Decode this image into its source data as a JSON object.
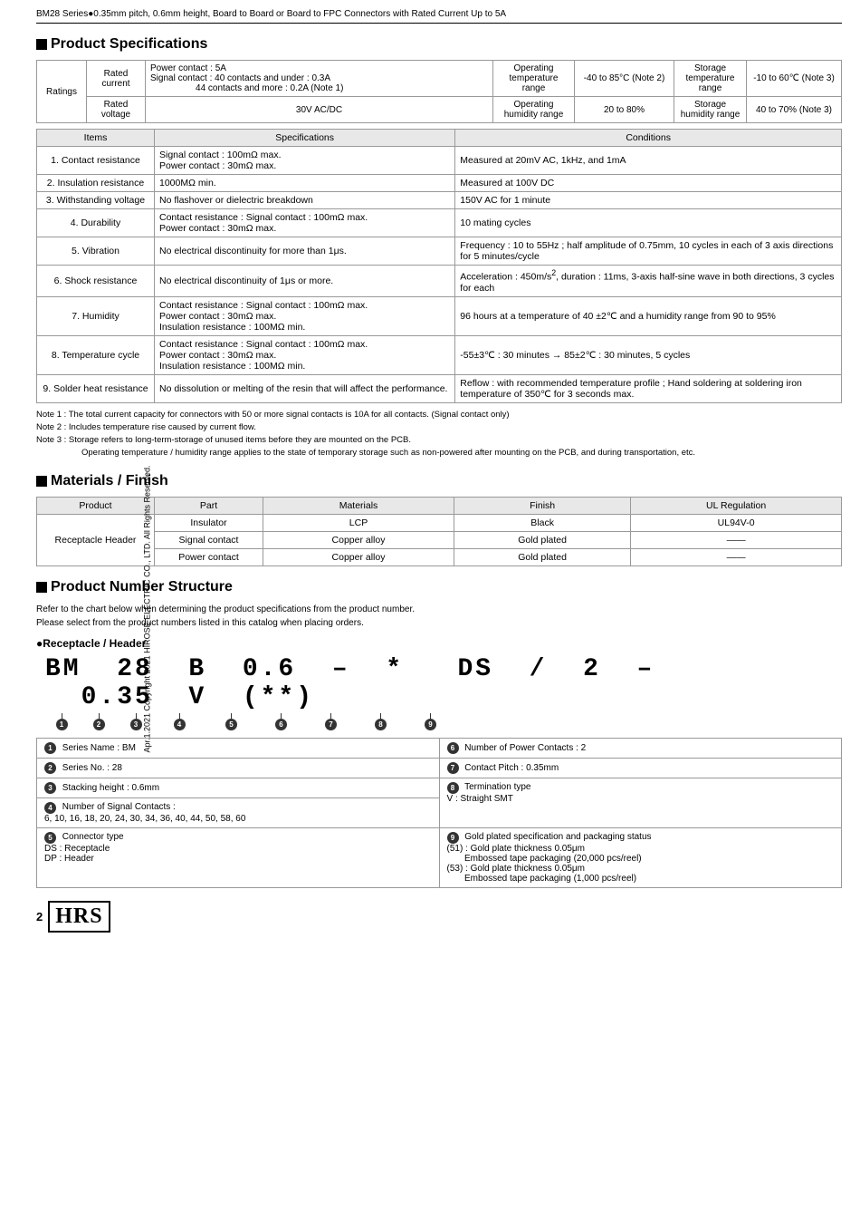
{
  "page": {
    "header": "BM28 Series●0.35mm pitch, 0.6mm height, Board to Board or Board to FPC Connectors with Rated Current Up to 5A",
    "side_text": "Apr.1.2021 Copyright 2021 HIROSE ELECTRIC CO., LTD. All Rights Reserved.",
    "page_number": "2"
  },
  "product_specs": {
    "heading": "Product Specifications",
    "ratings": {
      "rows": [
        {
          "label": "Ratings",
          "sub_label": "Rated current",
          "value": "Power contact : 5A\nSignal contact : 40 contacts and under : 0.3A\n44 contacts and more : 0.2A (Note 1)",
          "op_temp_label": "Operating temperature range",
          "op_temp_val": "-40 to 85°C (Note 2)",
          "storage_label": "Storage temperature range",
          "storage_val": "-10 to 60℃ (Note 3)"
        },
        {
          "sub_label": "Rated voltage",
          "value": "30V AC/DC",
          "op_temp_label": "Operating humidity range",
          "op_temp_val": "20 to 80%",
          "storage_label": "Storage humidity range",
          "storage_val": "40 to 70% (Note 3)"
        }
      ]
    },
    "specs_table": {
      "headers": [
        "Items",
        "Specifications",
        "Conditions"
      ],
      "rows": [
        {
          "item": "1. Contact resistance",
          "spec": "Signal contact : 100mΩ max.\nPower contact : 30mΩ max.",
          "cond": "Measured at 20mV AC, 1kHz, and 1mA"
        },
        {
          "item": "2. Insulation resistance",
          "spec": "1000MΩ min.",
          "cond": "Measured at 100V DC"
        },
        {
          "item": "3. Withstanding voltage",
          "spec": "No flashover or dielectric breakdown",
          "cond": "150V AC for 1 minute"
        },
        {
          "item": "4. Durability",
          "spec": "Contact resistance : Signal contact : 100mΩ max.\nPower contact : 30mΩ max.",
          "cond": "10 mating cycles"
        },
        {
          "item": "5. Vibration",
          "spec": "No electrical discontinuity for more than 1μs.",
          "cond": "Frequency : 10 to 55Hz ; half amplitude of 0.75mm, 10 cycles in each of 3 axis directions for 5 minutes/cycle"
        },
        {
          "item": "6. Shock resistance",
          "spec": "No electrical discontinuity of 1μs or more.",
          "cond": "Acceleration : 450m/s², duration : 11ms, 3-axis half-sine wave in both directions, 3 cycles for each"
        },
        {
          "item": "7. Humidity",
          "spec": "Contact resistance : Signal contact : 100mΩ max.\nPower contact : 30mΩ max.\nInsulation resistance : 100MΩ min.",
          "cond": "96 hours at a temperature of 40 ±2℃ and a humidity range from 90 to 95%"
        },
        {
          "item": "8. Temperature cycle",
          "spec": "Contact resistance : Signal contact : 100mΩ max.\nPower contact : 30mΩ max.\nInsulation resistance : 100MΩ min.",
          "cond": "-55±3℃ : 30 minutes → 85±2℃ : 30 minutes, 5 cycles"
        },
        {
          "item": "9. Solder heat resistance",
          "spec": "No dissolution or melting of the resin that will affect the performance.",
          "cond": "Reflow : with recommended temperature profile ; Hand soldering at soldering iron temperature of 350℃ for 3 seconds max."
        }
      ]
    },
    "notes": [
      "Note 1 : The total current capacity for connectors with 50 or more signal contacts is 10A for all contacts. (Signal contact only)",
      "Note 2 : Includes temperature rise caused by current flow.",
      "Note 3 : Storage refers to long-term-storage of unused items before they are mounted on the PCB.",
      "Operating temperature / humidity range applies to the state of temporary storage such as non-powered after mounting on the PCB, and during transportation, etc."
    ]
  },
  "materials_finish": {
    "heading": "Materials / Finish",
    "table": {
      "headers": [
        "Product",
        "Part",
        "Materials",
        "Finish",
        "UL Regulation"
      ],
      "rows": [
        {
          "product": "Receptacle Header",
          "part": "Insulator",
          "materials": "LCP",
          "finish": "Black",
          "ul": "UL94V-0"
        },
        {
          "product": "",
          "part": "Signal contact",
          "materials": "Copper alloy",
          "finish": "Gold plated",
          "ul": "——"
        },
        {
          "product": "",
          "part": "Power contact",
          "materials": "Copper alloy",
          "finish": "Gold plated",
          "ul": "——"
        }
      ]
    }
  },
  "product_number_structure": {
    "heading": "Product Number Structure",
    "description_lines": [
      "Refer to the chart below when determining the product specifications from the product number.",
      "Please select from the product numbers listed in this catalog when placing orders."
    ],
    "sub_heading": "●Receptacle / Header",
    "pn_display": "BM 28 B 0.6 – * DS / 2 – 0.35 V (**)",
    "indicators": [
      "①",
      "②",
      "③",
      "④",
      "⑤",
      "⑥",
      "⑦",
      "⑧",
      "⑨"
    ],
    "explanations": [
      {
        "num": "①",
        "label": "Series Name : BM"
      },
      {
        "num": "⑥",
        "label": "Number of Power Contacts : 2"
      },
      {
        "num": "②",
        "label": "Series No. : 28"
      },
      {
        "num": "⑦",
        "label": "Contact Pitch : 0.35mm"
      },
      {
        "num": "③",
        "label": "Stacking height : 0.6mm"
      },
      {
        "num": "⑧",
        "label": "Termination type\nV : Straight SMT"
      },
      {
        "num": "④",
        "label": "Number of Signal Contacts :\n6, 10, 16, 18, 20, 24, 30, 34, 36, 40, 44, 50, 58, 60"
      },
      {
        "num": "⑨",
        "label": "Gold plated specification and packaging status\n(51) : Gold plate thickness 0.05μm\n       Embossed tape packaging (20,000 pcs/reel)\n(53) : Gold plate thickness 0.05μm\n       Embossed tape packaging (1,000 pcs/reel)"
      },
      {
        "num": "⑤",
        "label": "Connector type\nDS : Receptacle\nDP : Header"
      }
    ]
  },
  "footer": {
    "page_num": "2",
    "logo": "HRS"
  }
}
